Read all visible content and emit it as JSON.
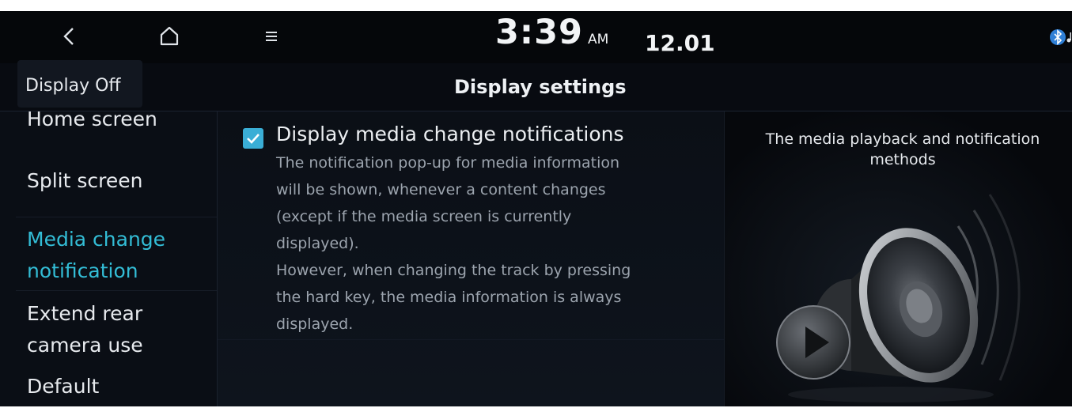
{
  "status_bar": {
    "time": "3:39",
    "ampm": "AM",
    "date": "12.01",
    "icons": [
      "back-icon",
      "home-icon",
      "menu-icon",
      "bluetooth-icon"
    ]
  },
  "header": {
    "display_off_label": "Display Off",
    "title": "Display settings"
  },
  "sidebar": {
    "items": [
      {
        "label_lines": [
          "Home screen"
        ],
        "active": false
      },
      {
        "label_lines": [
          "Split screen"
        ],
        "active": false
      },
      {
        "label_lines": [
          "Media change",
          "notification"
        ],
        "active": true
      },
      {
        "label_lines": [
          "Extend rear",
          "camera use"
        ],
        "active": false
      },
      {
        "label_lines": [
          "Default"
        ],
        "active": false
      }
    ]
  },
  "content": {
    "option": {
      "checked": true,
      "title": "Display media change notifications",
      "description_lines": [
        "The notification pop-up for media information",
        "will be shown, whenever a content changes",
        "(except if the media screen is currently",
        "displayed).",
        "However, when changing the track by pressing",
        "the hard key, the media information is always",
        "displayed."
      ]
    }
  },
  "preview": {
    "caption_lines": [
      "The media playback and notification",
      "methods"
    ],
    "illustration": "speaker-with-play-button"
  },
  "colors": {
    "background": "#080b11",
    "accent": "#33bdd6",
    "checkbox": "#3aaed6",
    "muted_text": "#9ca4ae"
  }
}
